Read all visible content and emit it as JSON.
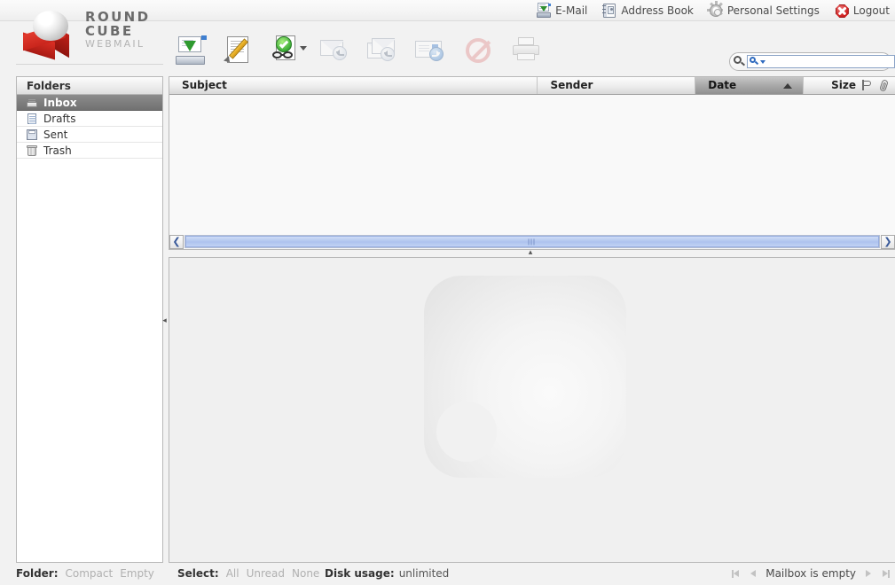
{
  "app": {
    "name": "Roundcube Webmail",
    "logo_line1": "ROUND",
    "logo_line2": "CUBE",
    "logo_line3": "WEBMAIL",
    "brand_red": "#cc1f1f",
    "accent_blue": "#3f7fd0"
  },
  "taskbar": [
    {
      "label": "E-Mail",
      "icon": "email-icon"
    },
    {
      "label": "Address Book",
      "icon": "address-book-icon"
    },
    {
      "label": "Personal Settings",
      "icon": "gear-icon"
    },
    {
      "label": "Logout",
      "icon": "logout-icon"
    }
  ],
  "toolbar": [
    {
      "label": "Check Mail",
      "icon": "check-mail-icon",
      "enabled": true
    },
    {
      "label": "Compose",
      "icon": "compose-icon",
      "enabled": true
    },
    {
      "label": "Mark",
      "icon": "mark-message-icon",
      "enabled": true
    },
    {
      "label": "Reply",
      "icon": "reply-icon",
      "enabled": false
    },
    {
      "label": "Reply to All",
      "icon": "reply-all-icon",
      "enabled": false
    },
    {
      "label": "Forward",
      "icon": "forward-icon",
      "enabled": false
    },
    {
      "label": "Delete",
      "icon": "delete-icon",
      "enabled": false
    },
    {
      "label": "Print",
      "icon": "print-icon",
      "enabled": false
    }
  ],
  "search": {
    "value": "",
    "placeholder": "",
    "icon": "search-icon",
    "scope_icon": "search-scope-icon",
    "clear_icon": "clear-icon"
  },
  "folders": {
    "title": "Folders",
    "items": [
      {
        "label": "Inbox",
        "icon": "inbox-icon",
        "selected": true
      },
      {
        "label": "Drafts",
        "icon": "drafts-icon",
        "selected": false
      },
      {
        "label": "Sent",
        "icon": "sent-icon",
        "selected": false
      },
      {
        "label": "Trash",
        "icon": "trash-icon",
        "selected": false
      }
    ]
  },
  "message_list": {
    "columns": [
      {
        "label": "Subject",
        "sorted": false
      },
      {
        "label": "Sender",
        "sorted": false
      },
      {
        "label": "Date",
        "sorted": true,
        "sort_direction": "ascending"
      },
      {
        "label": "Size",
        "sorted": false
      }
    ],
    "header_icons": [
      "flag-icon",
      "attachment-icon"
    ],
    "rows": []
  },
  "scrollbar": {
    "left_arrow": "❮",
    "right_arrow": "❯"
  },
  "splitters": {
    "horizontal_handle": "▴",
    "vertical_handle": "◂"
  },
  "preview": {
    "watermark": "roundcube-watermark"
  },
  "footer": {
    "folder_label": "Folder:",
    "folder_actions": [
      "Compact",
      "Empty"
    ],
    "select_label": "Select:",
    "select_actions": [
      "All",
      "Unread",
      "None"
    ],
    "disk_label": "Disk usage:",
    "disk_value": "unlimited",
    "pager_status": "Mailbox is empty",
    "pager_buttons": [
      "first-page",
      "previous-page",
      "next-page",
      "last-page"
    ]
  }
}
